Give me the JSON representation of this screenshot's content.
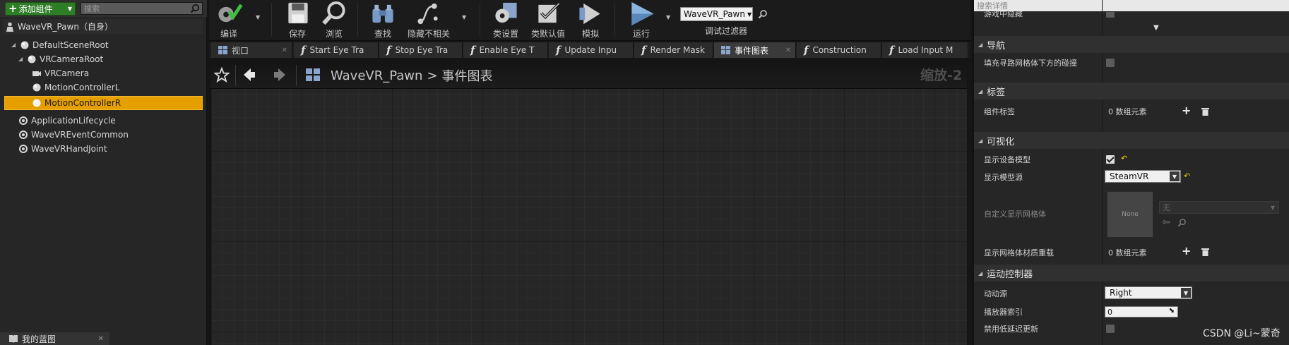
{
  "left_panel": {
    "add_component_label": "添加组件",
    "search_placeholder": "搜索",
    "self_label": "WaveVR_Pawn（自身）",
    "tree": [
      {
        "label": "DefaultSceneRoot"
      },
      {
        "label": "VRCameraRoot"
      },
      {
        "label": "VRCamera"
      },
      {
        "label": "MotionControllerL"
      },
      {
        "label": "MotionControllerR",
        "selected": true
      },
      {
        "label": "ApplicationLifecycle"
      },
      {
        "label": "WaveVREventCommon"
      },
      {
        "label": "WaveVRHandJoint"
      }
    ],
    "my_blueprint_tab": "我的蓝图",
    "selection_color": "#e5a000"
  },
  "toolbar": {
    "compile": "编译",
    "save": "保存",
    "browse": "浏览",
    "find": "查找",
    "hide_unrelated": "隐藏不相关",
    "class_settings": "类设置",
    "class_defaults": "类默认值",
    "simulate": "模拟",
    "play": "运行",
    "debug_object": "WaveVR_Pawn",
    "debug_filter": "调试过滤器"
  },
  "tabs": [
    {
      "label": "视口",
      "icon": "viewport-icon"
    },
    {
      "label": "Start Eye Tra",
      "icon": "function-icon"
    },
    {
      "label": "Stop Eye Tra",
      "icon": "function-icon"
    },
    {
      "label": "Enable Eye T",
      "icon": "function-icon"
    },
    {
      "label": "Update Inpu",
      "icon": "function-icon"
    },
    {
      "label": "Render Mask",
      "icon": "function-icon"
    },
    {
      "label": "事件图表",
      "icon": "event-graph-icon",
      "active": true
    },
    {
      "label": "Construction",
      "icon": "function-icon"
    },
    {
      "label": "Load Input M",
      "icon": "function-icon"
    }
  ],
  "graph": {
    "breadcrumb_root": "WaveVR_Pawn",
    "breadcrumb_sep": ">",
    "breadcrumb_current": "事件图表",
    "zoom_text": "缩放-2"
  },
  "details": {
    "search_placeholder": "搜索详情",
    "cut_row_label": "游戏中隐藏",
    "sections": {
      "navigation": "导航",
      "tags": "标签",
      "rendering": "可视化",
      "motion": "运动控制器"
    },
    "rows": {
      "nav_collision": "填充寻路网格体下方的碰撞",
      "component_tags": "组件标签",
      "component_tags_value": "0 数组元素",
      "show_device_model": "显示设备模型",
      "display_model_source": "显示模型源",
      "display_model_source_value": "SteamVR",
      "custom_mesh": "自定义显示网格体",
      "custom_mesh_thumb": "None",
      "custom_mesh_value": "无",
      "mat_override": "显示网格体材质重载",
      "mat_override_value": "0 数组元素",
      "motion_source": "动动源",
      "motion_source_value": "Right",
      "player_index": "播放器索引",
      "player_index_value": "0",
      "disable_low_latency": "禁用低延迟更新"
    }
  },
  "watermark": "CSDN @Li~蒙奇"
}
